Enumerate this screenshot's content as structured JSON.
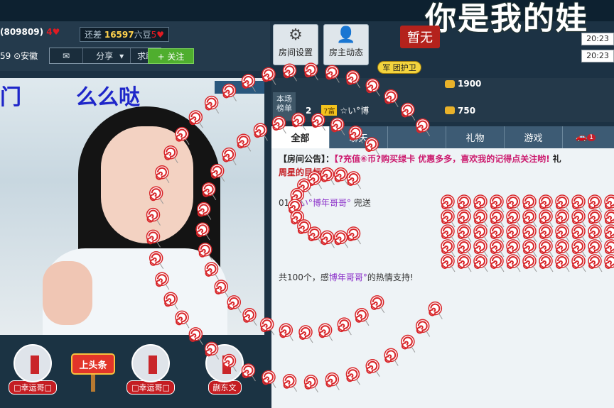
{
  "header": {
    "big_title": "你是我的娃",
    "host_name_id": "(809809)",
    "host_level": "4",
    "gap_label": "还差",
    "gap_value": "16597",
    "gap_unit": "六豆",
    "gap_level": "5",
    "live_time": "59",
    "location": "安徽",
    "share_label": "分享",
    "help_label": "求助",
    "follow_label": "+ 关注"
  },
  "toolbar": {
    "room_settings": "房间设置",
    "host_feed": "房主动态",
    "none_badge": "暂无",
    "guard_label": "团护卫",
    "guard_prefix": "军",
    "times": [
      "20:23",
      "20:23"
    ]
  },
  "video": {
    "caption_left": "门",
    "caption_right": "么么哒"
  },
  "fans": [
    {
      "label": "□幸运哥□"
    },
    {
      "label": "□幸运哥□"
    },
    {
      "label": "蒯东文"
    }
  ],
  "headline_label": "上头条",
  "rank": {
    "label": "本场榜单",
    "rows": [
      {
        "num": "",
        "points": "1900",
        "name": ""
      },
      {
        "num": "2",
        "level": "7富",
        "name": "☆い°博",
        "points": "750"
      }
    ]
  },
  "tabs": [
    "全部",
    "聊天",
    "",
    "礼物",
    "游戏",
    ""
  ],
  "tab_badge": "1",
  "notice": {
    "key": "【房间公告】：",
    "value": "【?充值⑥币?购买绿卡 优惠多多，喜欢我的记得点关注哟!",
    "tail": "礼"
  },
  "target": "周星的目标是：",
  "gift_line": {
    "time": "01",
    "name": "☆い°博年哥哥°",
    "suffix": "兜送"
  },
  "thank_line": {
    "prefix": "共100个，感",
    "name": "博年哥哥°",
    "suffix": "的热情支持!"
  },
  "colors": {
    "accent": "#4fae2e",
    "candy": "#d8262a",
    "link": "#8b2fc9"
  }
}
